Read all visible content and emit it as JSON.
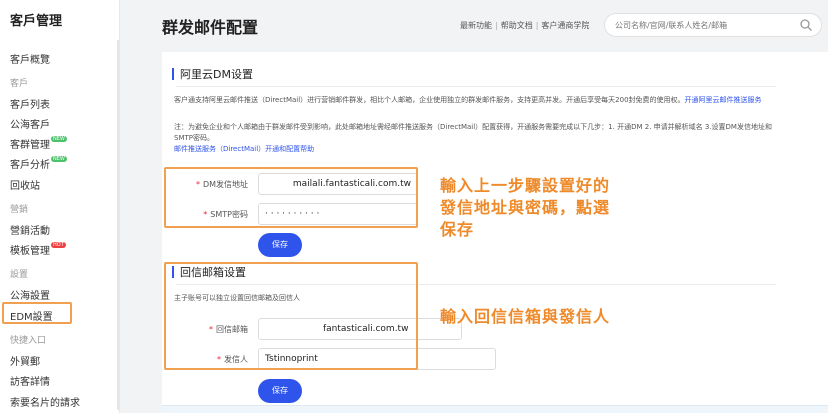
{
  "sidebar": {
    "title": "客戶管理",
    "overview": "客戶概覽",
    "group_customer": "客戶",
    "customer_list": "客戶列表",
    "public_customers": "公海客戶",
    "customer_groups": "客群管理",
    "customer_analysis": "客戶分析",
    "recycle_bin": "回收站",
    "group_marketing": "營銷",
    "marketing_activities": "營銷活動",
    "template_management": "模板管理",
    "group_settings": "設置",
    "public_settings": "公海設置",
    "edm_settings": "EDM設置",
    "group_quick": "快捷入口",
    "trade_mail": "外貿郵",
    "visitor_details": "訪客詳情",
    "card_requests": "索要名片的請求",
    "badge_new": "NEW",
    "badge_hot": "HOT"
  },
  "header": {
    "title": "群发邮件配置",
    "links": [
      "最新功能",
      "帮助文档",
      "客户通商学院"
    ],
    "search_placeholder": "公司名称/官网/联系人姓名/邮箱"
  },
  "dm_section": {
    "title": "阿里云DM设置",
    "desc_main": "客户通支持阿里云邮件推送（DirectMail）进行营销邮件群发，相比个人邮箱，企业使用独立的群发邮件服务，支持更高并发。开通后享受每天200封免费的使用权。",
    "desc_link1": "开通阿里云邮件推送服务",
    "desc_note": "注：为避免企业和个人邮箱由于群发邮件受到影响，此处邮箱地址需经邮件推送服务（DirectMail）配置获得，开通服务需要完成以下几步：1. 开通DM 2. 申请并解析域名 3.设置DM发信地址和SMTP密码。",
    "desc_link2": "邮件推送服务（DirectMail）开通和配置帮助",
    "sender_label": "DM发信地址",
    "sender_value": "mailali.fantasticali.com.tw",
    "smtp_label": "SMTP密码",
    "smtp_value": "· · · · · · · · · ·",
    "save_label": "保存"
  },
  "reply_section": {
    "title": "回信邮箱设置",
    "desc": "主子账号可以独立设置回信邮箱及回信人",
    "reply_label": "回信邮箱",
    "reply_value": "fantasticali.com.tw",
    "sender_name_label": "发信人",
    "sender_name_value": "Tstinnoprint",
    "save_label": "保存"
  },
  "annotations": {
    "first": [
      "輸入上一步驟設置好的",
      "發信地址與密碼，點選",
      "保存"
    ],
    "second": "輸入回信信箱與發信人"
  },
  "colors": {
    "accent": "#2f54eb",
    "annotation": "#ef8a2a",
    "required": "#e23"
  }
}
